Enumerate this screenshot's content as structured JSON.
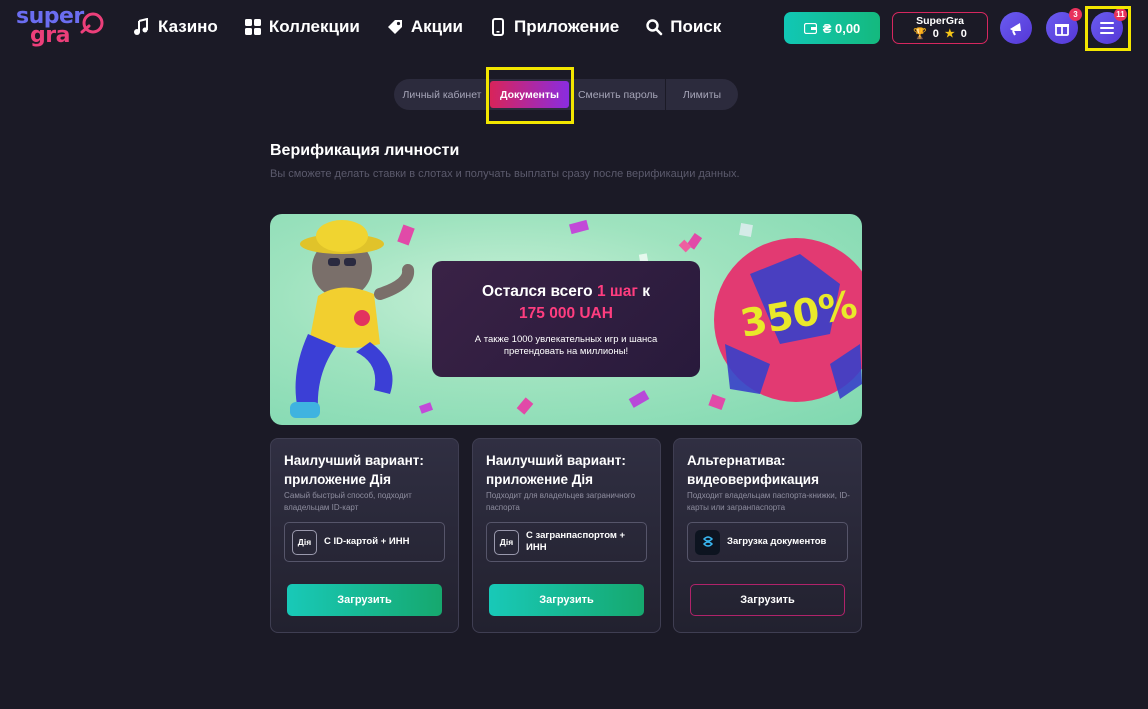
{
  "header": {
    "logo_top": "super",
    "logo_bottom": "gra",
    "nav": [
      {
        "label": "Казино",
        "icon": "music-notes-icon"
      },
      {
        "label": "Коллекции",
        "icon": "grid-icon"
      },
      {
        "label": "Акции",
        "icon": "tag-icon"
      },
      {
        "label": "Приложение",
        "icon": "phone-icon"
      },
      {
        "label": "Поиск",
        "icon": "search-icon"
      }
    ],
    "wallet": "₴ 0,00",
    "profile": {
      "name": "SuperGra",
      "trophies": "0",
      "stars": "0"
    },
    "gift_badge": "3",
    "menu_badge": "11"
  },
  "tabs": [
    {
      "label": "Личный кабинет"
    },
    {
      "label": "Документы",
      "active": true
    },
    {
      "label": "Сменить пароль"
    },
    {
      "label": "Лимиты"
    }
  ],
  "page": {
    "title": "Верификация личности",
    "subtitle": "Вы сможете делать ставки в слотах и получать выплаты сразу после верификации данных."
  },
  "banner": {
    "heading_pre": "Остался всего ",
    "heading_accent": "1 шаг",
    "heading_post": " к",
    "amount": "175 000 UAH",
    "description": "А также 1000 увлекательных игр и шанса претендовать на миллионы!",
    "ball_text": "350%"
  },
  "cards": [
    {
      "title": "Наилучший вариант: приложение Дія",
      "desc": "Самый быстрый способ, подходит владельцам ID-карт",
      "option_icon": "Дія",
      "option_label": "С ID-картой + ИНН",
      "button": "Загрузить"
    },
    {
      "title": "Наилучший вариант: приложение Дія",
      "desc": "Подходит для владельцев заграничного паспорта",
      "option_icon": "Дія",
      "option_label": "С загранпаспортом + ИНН",
      "button": "Загрузить"
    },
    {
      "title": "Альтернатива: видеоверификация",
      "desc": "Подходит владельцам паспорта-книжки, ID-карты или загранпаспорта",
      "option_label": "Загрузка документов",
      "button": "Загрузить"
    }
  ],
  "colors": {
    "background": "#1b1a26",
    "accent_pink": "#ff3d7f",
    "green": "#16a86e",
    "highlight": "#f3e600"
  }
}
